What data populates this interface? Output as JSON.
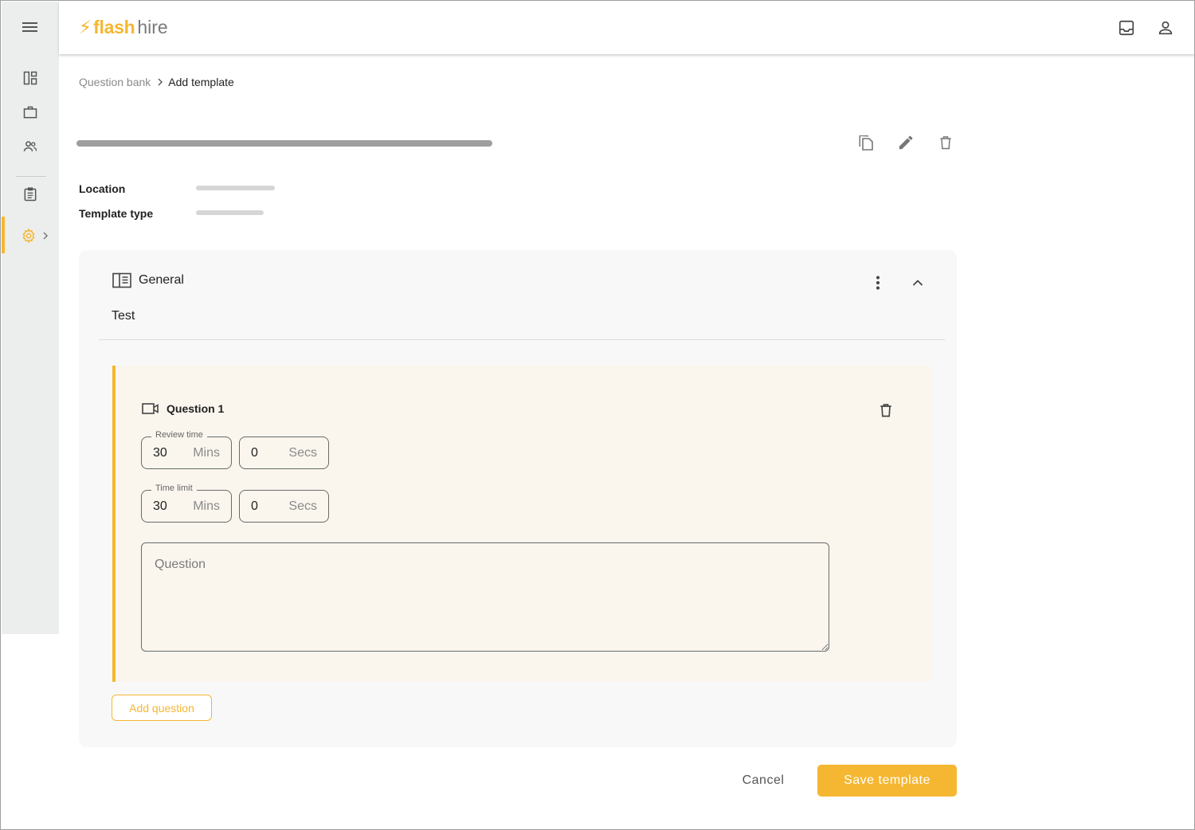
{
  "app": {
    "logo_bolt": "⚡",
    "logo_flash": "flash",
    "logo_hire": "hire",
    "accent_color": "#f5b731"
  },
  "sidebar": {
    "items": [
      {
        "icon": "dashboard-icon"
      },
      {
        "icon": "briefcase-icon"
      },
      {
        "icon": "people-icon"
      },
      {
        "icon": "clipboard-icon"
      },
      {
        "icon": "gear-icon",
        "active": true
      }
    ]
  },
  "topbar": {
    "icons": [
      "inbox-icon",
      "account-icon"
    ]
  },
  "breadcrumb": {
    "parent": "Question bank",
    "current": "Add template"
  },
  "template": {
    "location_label": "Location",
    "type_label": "Template type"
  },
  "section": {
    "title": "General",
    "description": "Test"
  },
  "question": {
    "title": "Question 1",
    "review_time": {
      "label": "Review time",
      "mins": "30",
      "mins_unit": "Mins",
      "secs": "0",
      "secs_unit": "Secs"
    },
    "time_limit": {
      "label": "Time limit",
      "mins": "30",
      "mins_unit": "Mins",
      "secs": "0",
      "secs_unit": "Secs"
    },
    "question_placeholder": "Question"
  },
  "buttons": {
    "add_question": "Add question",
    "cancel": "Cancel",
    "save": "Save template"
  }
}
